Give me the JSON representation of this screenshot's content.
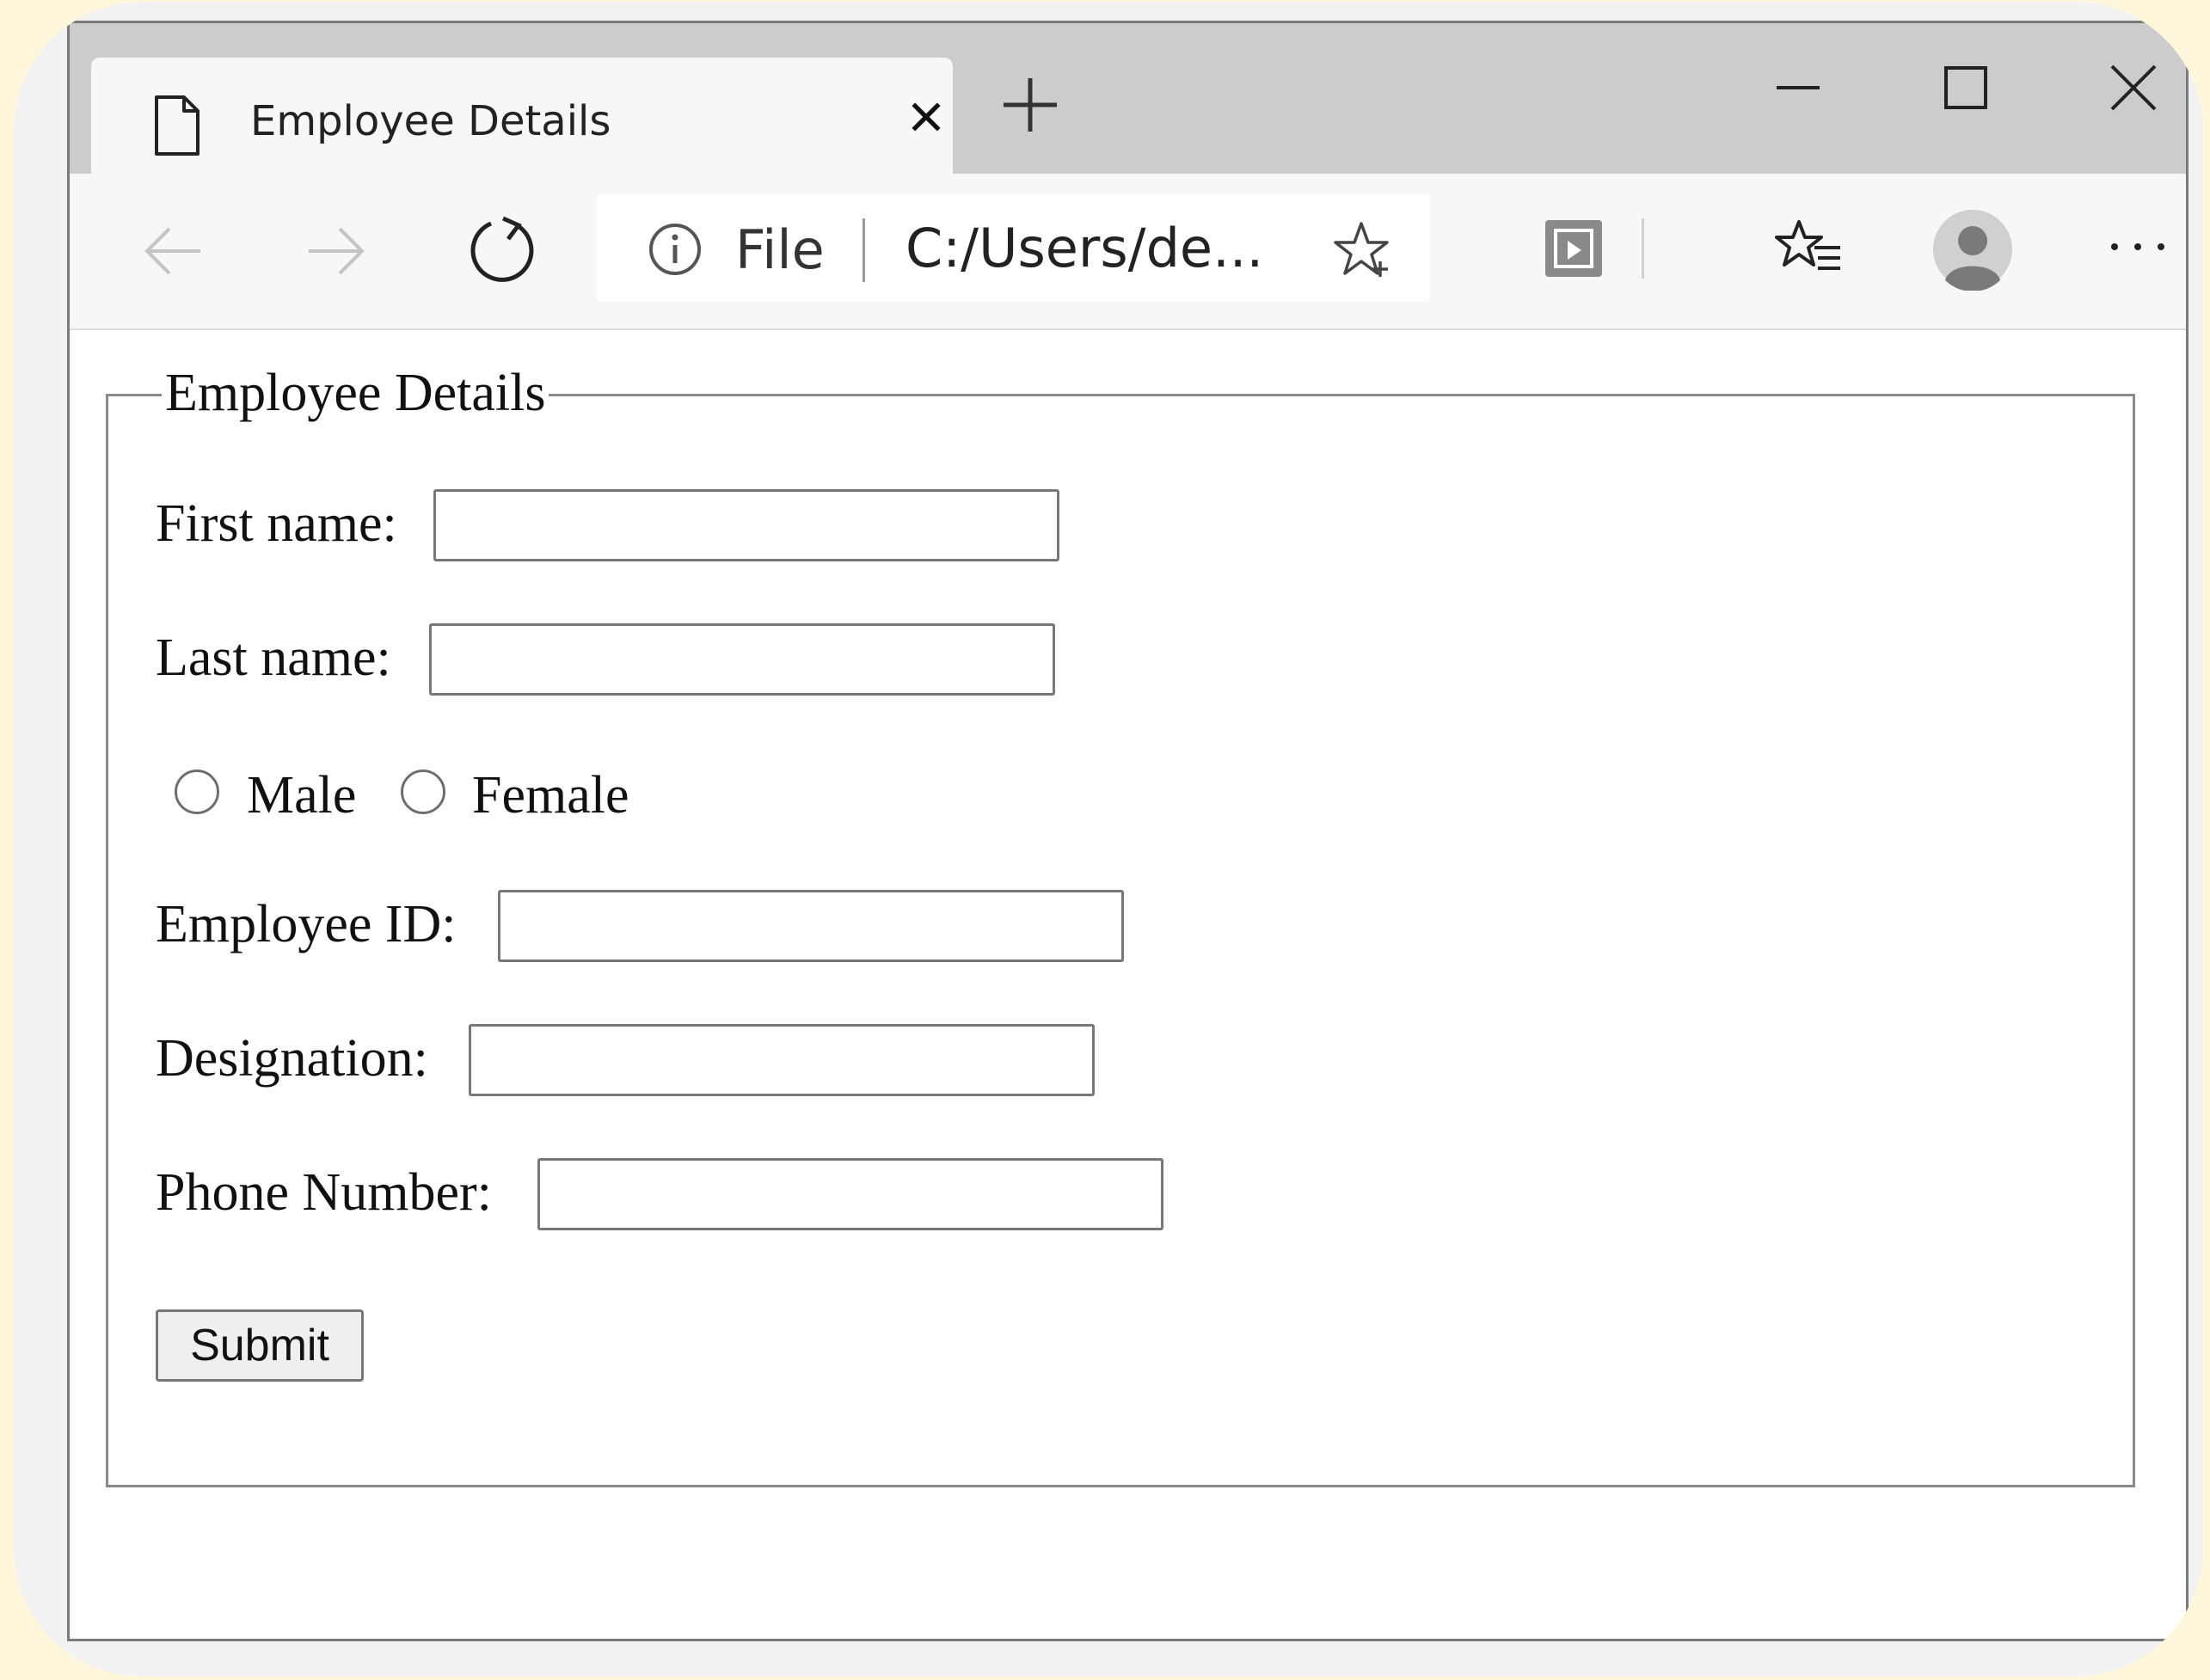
{
  "tab": {
    "title": "Employee Details"
  },
  "address_bar": {
    "scheme_label": "File",
    "url": "C:/Users/de..."
  },
  "form": {
    "legend": "Employee Details",
    "first_name": {
      "label": "First name:",
      "value": ""
    },
    "last_name": {
      "label": "Last name:",
      "value": ""
    },
    "gender": {
      "options": [
        {
          "label": "Male",
          "selected": false
        },
        {
          "label": "Female",
          "selected": false
        }
      ]
    },
    "employee_id": {
      "label": "Employee ID:",
      "value": ""
    },
    "designation": {
      "label": "Designation:",
      "value": ""
    },
    "phone": {
      "label": "Phone Number:",
      "value": ""
    },
    "submit_label": "Submit"
  },
  "colors": {
    "background": "#fff6dc",
    "tabstrip": "#cccccc",
    "toolbar": "#f7f7f7",
    "page": "#ffffff"
  }
}
